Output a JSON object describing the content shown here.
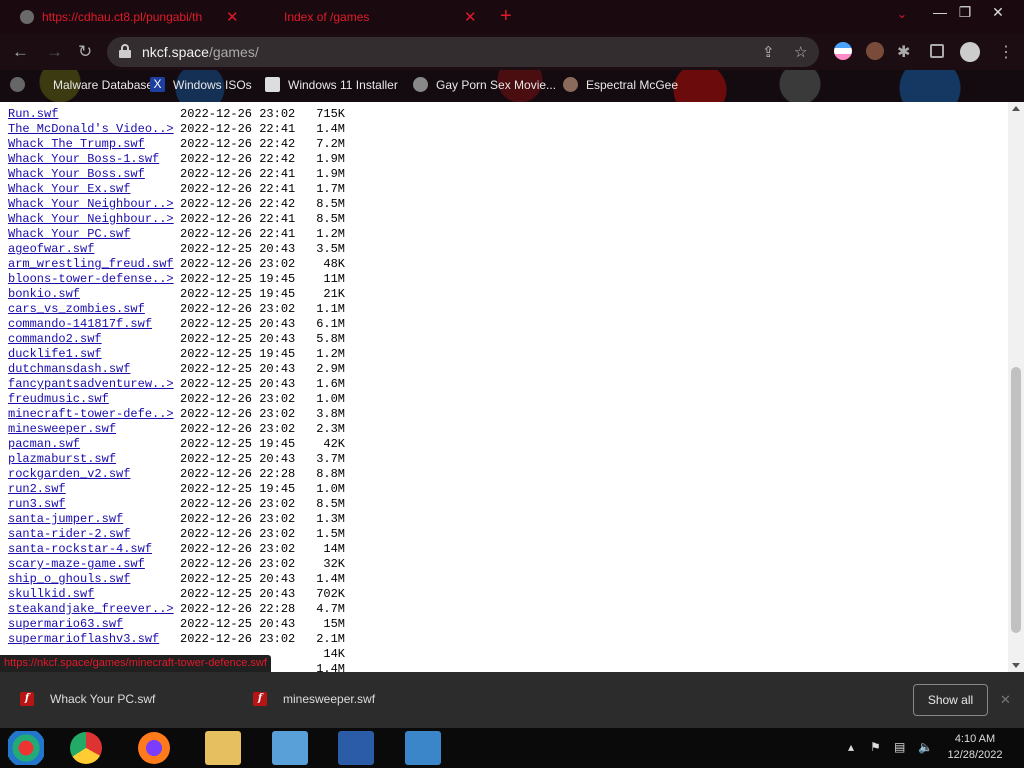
{
  "browser": {
    "tabs": [
      {
        "title": "https://cdhau.ct8.pl/pungabi/th"
      },
      {
        "title": "Index of /games"
      }
    ],
    "address": {
      "host": "nkcf.space",
      "path": "/games/"
    },
    "bookmarks": [
      {
        "label": "Malware Database"
      },
      {
        "label": "Windows ISOs"
      },
      {
        "label": "Windows 11 Installer"
      },
      {
        "label": "Gay Porn Sex Movie..."
      },
      {
        "label": "Espectral McGee"
      }
    ]
  },
  "listing": {
    "rows": [
      {
        "name": "Run.swf",
        "date": "2022-12-26 23:02",
        "size": "715K"
      },
      {
        "name": "The McDonald's Video..>",
        "date": "2022-12-26 22:41",
        "size": "1.4M"
      },
      {
        "name": "Whack The Trump.swf",
        "date": "2022-12-26 22:42",
        "size": "7.2M"
      },
      {
        "name": "Whack Your Boss-1.swf",
        "date": "2022-12-26 22:42",
        "size": "1.9M"
      },
      {
        "name": "Whack Your Boss.swf",
        "date": "2022-12-26 22:41",
        "size": "1.9M"
      },
      {
        "name": "Whack Your Ex.swf",
        "date": "2022-12-26 22:41",
        "size": "1.7M"
      },
      {
        "name": "Whack Your Neighbour..>",
        "date": "2022-12-26 22:42",
        "size": "8.5M"
      },
      {
        "name": "Whack Your Neighbour..>",
        "date": "2022-12-26 22:41",
        "size": "8.5M"
      },
      {
        "name": "Whack Your PC.swf",
        "date": "2022-12-26 22:41",
        "size": "1.2M"
      },
      {
        "name": "ageofwar.swf",
        "date": "2022-12-25 20:43",
        "size": "3.5M"
      },
      {
        "name": "arm_wrestling_freud.swf",
        "date": "2022-12-26 23:02",
        "size": "48K"
      },
      {
        "name": "bloons-tower-defense..>",
        "date": "2022-12-25 19:45",
        "size": "11M"
      },
      {
        "name": "bonkio.swf",
        "date": "2022-12-25 19:45",
        "size": "21K"
      },
      {
        "name": "cars_vs_zombies.swf",
        "date": "2022-12-26 23:02",
        "size": "1.1M"
      },
      {
        "name": "commando-141817f.swf",
        "date": "2022-12-25 20:43",
        "size": "6.1M"
      },
      {
        "name": "commando2.swf",
        "date": "2022-12-25 20:43",
        "size": "5.8M"
      },
      {
        "name": "ducklife1.swf",
        "date": "2022-12-25 19:45",
        "size": "1.2M"
      },
      {
        "name": "dutchmansdash.swf",
        "date": "2022-12-25 20:43",
        "size": "2.9M"
      },
      {
        "name": "fancypantsadventurew..>",
        "date": "2022-12-25 20:43",
        "size": "1.6M"
      },
      {
        "name": "freudmusic.swf",
        "date": "2022-12-26 23:02",
        "size": "1.0M"
      },
      {
        "name": "minecraft-tower-defe..>",
        "date": "2022-12-26 23:02",
        "size": "3.8M"
      },
      {
        "name": "minesweeper.swf",
        "date": "2022-12-26 23:02",
        "size": "2.3M"
      },
      {
        "name": "pacman.swf",
        "date": "2022-12-25 19:45",
        "size": "42K"
      },
      {
        "name": "plazmaburst.swf",
        "date": "2022-12-25 20:43",
        "size": "3.7M"
      },
      {
        "name": "rockgarden_v2.swf",
        "date": "2022-12-26 22:28",
        "size": "8.8M"
      },
      {
        "name": "run2.swf",
        "date": "2022-12-25 19:45",
        "size": "1.0M"
      },
      {
        "name": "run3.swf",
        "date": "2022-12-26 23:02",
        "size": "8.5M"
      },
      {
        "name": "santa-jumper.swf",
        "date": "2022-12-26 23:02",
        "size": "1.3M"
      },
      {
        "name": "santa-rider-2.swf",
        "date": "2022-12-26 23:02",
        "size": "1.5M"
      },
      {
        "name": "santa-rockstar-4.swf",
        "date": "2022-12-26 23:02",
        "size": "14M"
      },
      {
        "name": "scary-maze-game.swf",
        "date": "2022-12-26 23:02",
        "size": "32K"
      },
      {
        "name": "ship_o_ghouls.swf",
        "date": "2022-12-25 20:43",
        "size": "1.4M"
      },
      {
        "name": "skullkid.swf",
        "date": "2022-12-25 20:43",
        "size": "702K"
      },
      {
        "name": "steakandjake_freever..>",
        "date": "2022-12-26 22:28",
        "size": "4.7M"
      },
      {
        "name": "supermario63.swf",
        "date": "2022-12-25 20:43",
        "size": "15M"
      },
      {
        "name": "supermarioflashv3.swf",
        "date": "2022-12-26 23:02",
        "size": "2.1M"
      },
      {
        "name": "",
        "date": "",
        "size": "14K"
      },
      {
        "name": "",
        "date": "",
        "size": "1.4M"
      }
    ]
  },
  "status_url": "https://nkcf.space/games/minecraft-tower-defence.swf",
  "downloads": {
    "items": [
      {
        "name": "Whack Your PC.swf"
      },
      {
        "name": "minesweeper.swf"
      }
    ],
    "show_all": "Show all"
  },
  "taskbar": {
    "time": "4:10 AM",
    "date": "12/28/2022"
  }
}
